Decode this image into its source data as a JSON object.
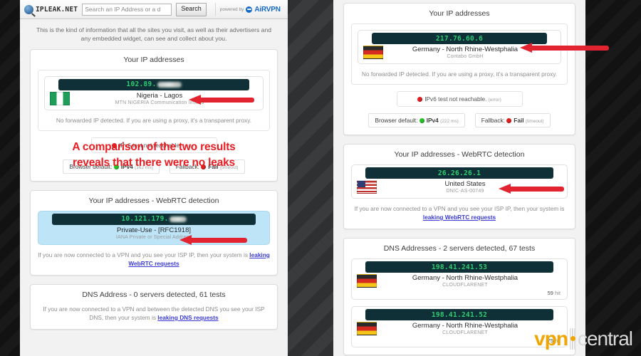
{
  "header": {
    "logo_text": "IPLEAK.NET",
    "logo_icon": "globe-magnifier-icon",
    "search_placeholder": "Search an IP Address or a d",
    "search_value": "",
    "search_button": "Search",
    "powered_by_label": "powered by",
    "powered_by_brand": "AiRVPN",
    "powered_by_icon": "airvpn-logo-icon"
  },
  "intro": "This is the kind of information that all the sites you visit, as well as their advertisers and any embedded widget, can see and collect about you.",
  "annotation": {
    "line1": "A comparison of the two results",
    "line2": "reveals that there were no leaks",
    "color": "#e81d22"
  },
  "left": {
    "ip_card": {
      "title": "Your IP addresses",
      "ip": "102.89.",
      "ip_redacted": true,
      "country": "Nigeria - Lagos",
      "isp": "MTN NIGERIA Communication limited",
      "flag": "flag-nigeria-icon",
      "note": "No forwarded IP detected. If you are using a proxy, it's a transparent proxy.",
      "ipv6_status": "IPv6 test not reachable.",
      "ipv6_status_detail": "(error)",
      "ipv6_dot": "red",
      "browser_default_label": "Browser default:",
      "browser_default_value": "IPv4",
      "browser_default_detail": "(162 ms)",
      "browser_default_dot": "green",
      "fallback_label": "Fallback:",
      "fallback_value": "Fail",
      "fallback_detail": "(timeout)",
      "fallback_dot": "red"
    },
    "webrtc_card": {
      "title": "Your IP addresses - WebRTC detection",
      "ip": "10.121.179.",
      "ip_redacted": true,
      "country": "Private-Use - [RFC1918]",
      "isp": "IANA Private or Special Address",
      "note_prefix": "If you are now connected to a VPN and you see your ISP IP, then your system is ",
      "note_link": "leaking WebRTC requests"
    },
    "dns_card": {
      "title": "DNS Address - 0 servers detected, 61 tests",
      "note_prefix": "If you are now connected to a VPN and between the detected DNS you see your ISP DNS, then your system is ",
      "note_link": "leaking DNS requests"
    }
  },
  "right": {
    "ip_card": {
      "title": "Your IP addresses",
      "ip": "217.76.60.6",
      "ip_redacted": false,
      "country": "Germany - North Rhine-Westphalia",
      "isp": "Contabo GmbH",
      "flag": "flag-germany-icon",
      "note": "No forwarded IP detected. If you are using a proxy, it's a transparent proxy.",
      "ipv6_status": "IPv6 test not reachable.",
      "ipv6_status_detail": "(error)",
      "ipv6_dot": "red",
      "browser_default_label": "Browser default:",
      "browser_default_value": "IPv4",
      "browser_default_detail": "(222 ms)",
      "browser_default_dot": "green",
      "fallback_label": "Fallback:",
      "fallback_value": "Fail",
      "fallback_detail": "(timeout)",
      "fallback_dot": "red"
    },
    "webrtc_card": {
      "title": "Your IP addresses - WebRTC detection",
      "ip": "26.26.26.1",
      "country": "United States",
      "isp": "DNIC-AS-00749",
      "flag": "flag-usa-icon",
      "note_prefix": "If you are now connected to a VPN and you see your ISP IP, then your system is ",
      "note_link": "leaking WebRTC requests"
    },
    "dns_card": {
      "title": "DNS Addresses - 2 servers detected, 67 tests",
      "servers": [
        {
          "ip": "198.41.241.53",
          "country": "Germany - North Rhine-Westphalia",
          "isp": "CLOUDFLARENET",
          "flag": "flag-germany-icon",
          "hits": "59",
          "hits_label": "hit"
        },
        {
          "ip": "198.41.241.52",
          "country": "Germany - North Rhine-Westphalia",
          "isp": "CLOUDFLARENET",
          "flag": "flag-germany-icon",
          "hits": "75",
          "hits_label": "hit"
        }
      ]
    }
  },
  "watermark": {
    "part1": "vpn",
    "part2": "central",
    "color1": "#f0a500",
    "color2": "#d9d9d9"
  }
}
